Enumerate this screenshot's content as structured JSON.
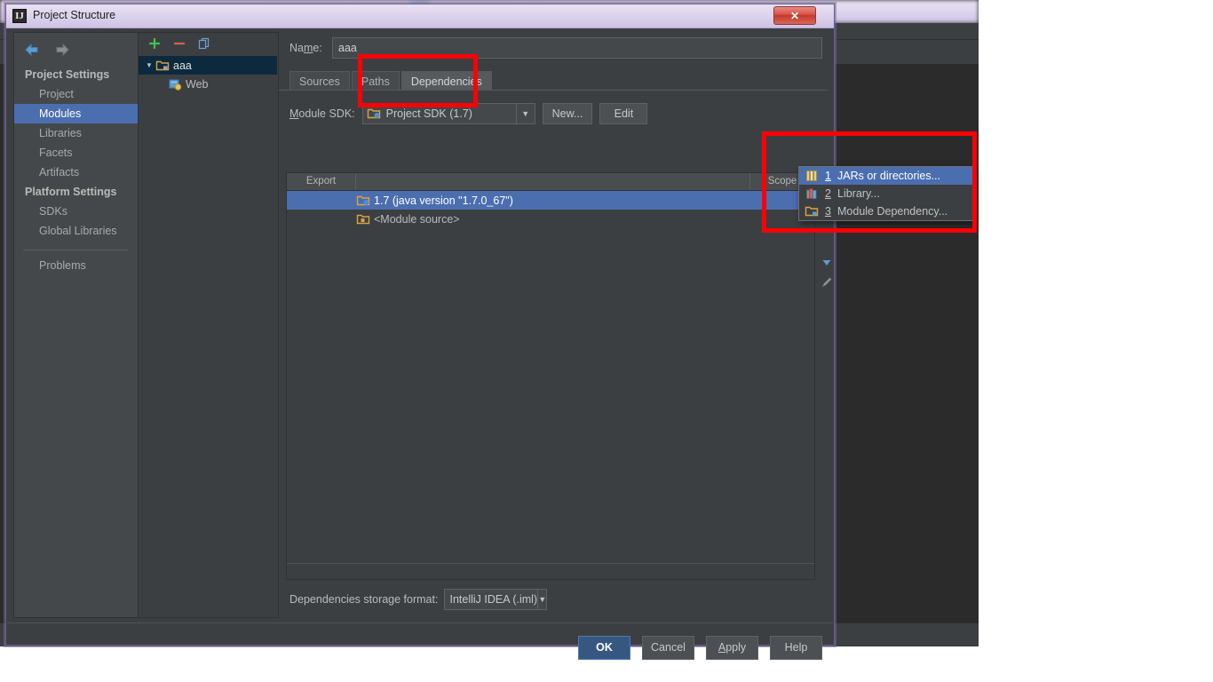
{
  "dialog": {
    "title": "Project Structure",
    "icon": "intellij-idea-logo",
    "close_label": "✕"
  },
  "sidebar": {
    "back_icon": "back-arrow-icon",
    "forward_icon": "forward-arrow-icon",
    "groups": [
      {
        "label": "Project Settings",
        "items": [
          {
            "label": "Project",
            "selected": false
          },
          {
            "label": "Modules",
            "selected": true
          },
          {
            "label": "Libraries",
            "selected": false
          },
          {
            "label": "Facets",
            "selected": false
          },
          {
            "label": "Artifacts",
            "selected": false
          }
        ]
      },
      {
        "label": "Platform Settings",
        "items": [
          {
            "label": "SDKs",
            "selected": false
          },
          {
            "label": "Global Libraries",
            "selected": false
          }
        ]
      }
    ],
    "problems_label": "Problems"
  },
  "module_tree": {
    "toolbar": [
      {
        "name": "add-module-icon",
        "glyph": "+"
      },
      {
        "name": "remove-module-icon",
        "glyph": "−"
      },
      {
        "name": "copy-module-icon",
        "glyph": "⧉"
      }
    ],
    "nodes": [
      {
        "label": "aaa",
        "icon": "module-folder-icon",
        "selected": true,
        "expanded": true,
        "depth": 0
      },
      {
        "label": "Web",
        "icon": "web-facet-icon",
        "selected": false,
        "expanded": null,
        "depth": 1
      }
    ]
  },
  "content": {
    "name_label": "Name:",
    "name_label_mnemonic": "m",
    "name_value": "aaa",
    "tabs": [
      {
        "label": "Sources",
        "active": false
      },
      {
        "label": "Paths",
        "active": false
      },
      {
        "label": "Dependencies",
        "active": true
      }
    ],
    "sdk": {
      "label": "Module SDK:",
      "label_mnemonic": "M",
      "value": "Project SDK (1.7)",
      "icon": "sdk-folder-icon",
      "new_button": "New...",
      "edit_button": "Edit"
    },
    "dependencies_table": {
      "columns": [
        "Export",
        "",
        "Scope"
      ],
      "rows": [
        {
          "export": false,
          "name": "1.7 (java version \"1.7.0_67\")",
          "icon": "jdk-icon",
          "scope": "",
          "selected": true
        },
        {
          "export": false,
          "name": "<Module source>",
          "icon": "module-source-icon",
          "scope": "",
          "selected": false
        }
      ]
    },
    "side_toolbar": [
      {
        "name": "add-dependency-icon",
        "glyph": "+"
      },
      {
        "name": "move-down-icon",
        "glyph": "▼"
      },
      {
        "name": "edit-dependency-icon",
        "glyph": "✎"
      }
    ],
    "storage": {
      "label": "Dependencies storage format:",
      "value": "IntelliJ IDEA (.iml)"
    }
  },
  "popup_menu": {
    "items": [
      {
        "number": "1",
        "label": "JARs or directories...",
        "icon": "jars-icon",
        "selected": true
      },
      {
        "number": "2",
        "label": "Library...",
        "icon": "library-icon",
        "selected": false
      },
      {
        "number": "3",
        "label": "Module Dependency...",
        "icon": "module-dependency-icon",
        "selected": false
      }
    ]
  },
  "buttons": {
    "ok": "OK",
    "cancel": "Cancel",
    "apply": "Apply",
    "apply_mnemonic": "A",
    "help": "Help"
  },
  "annotations": {
    "tab_highlight": "Dependencies tab highlighted",
    "menu_highlight": "Add dependency popup menu highlighted",
    "color": "#fb0007"
  }
}
